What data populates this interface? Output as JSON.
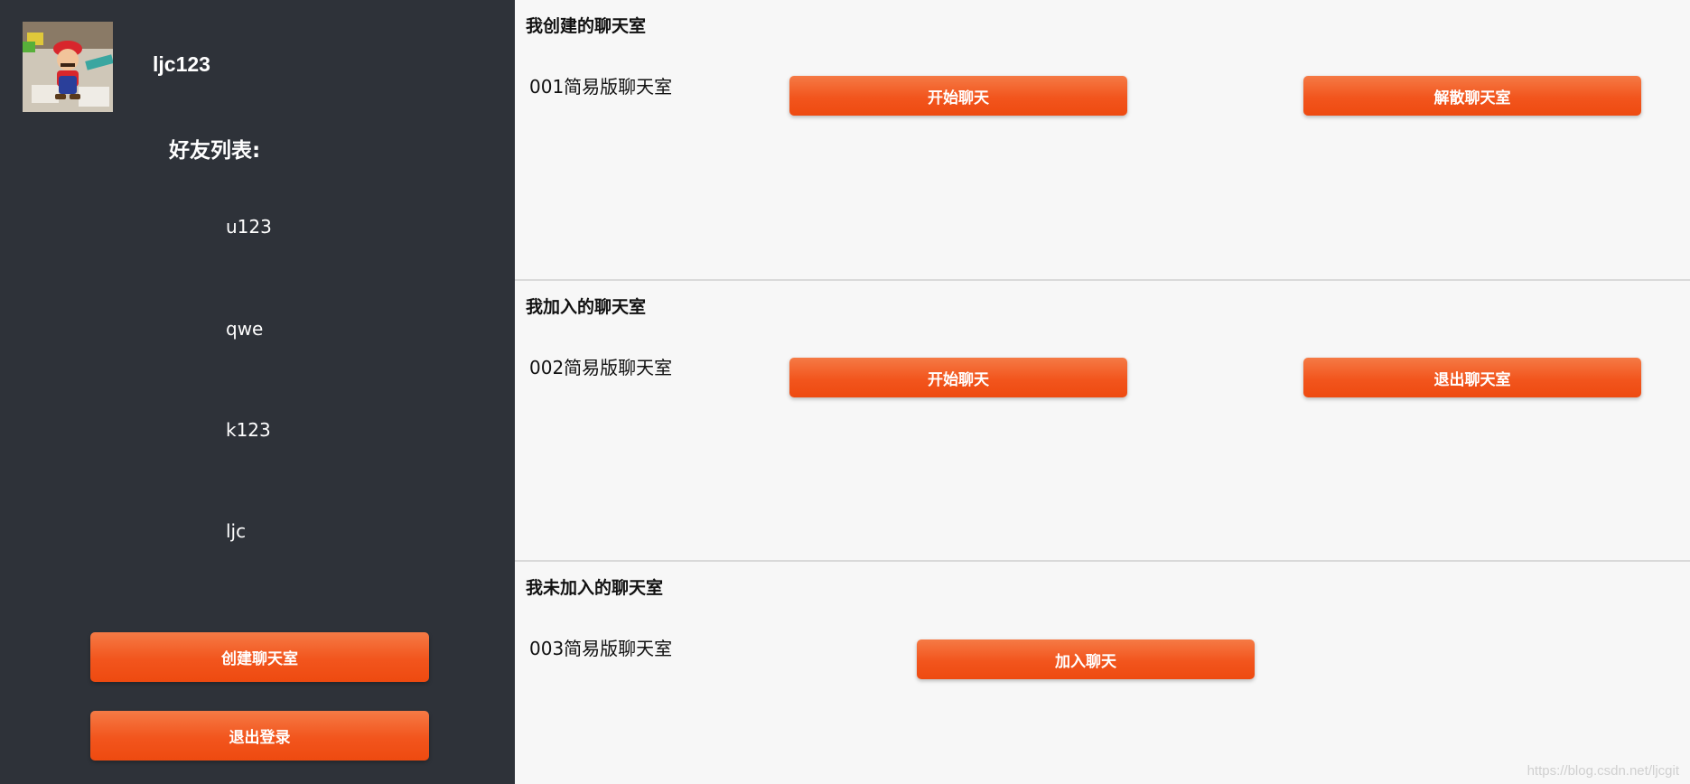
{
  "user": {
    "username": "ljc123"
  },
  "sidebar": {
    "friends_title": "好友列表:",
    "friends": [
      "u123",
      "qwe",
      "k123",
      "ljc"
    ],
    "create_room_label": "创建聊天室",
    "logout_label": "退出登录"
  },
  "sections": {
    "created": {
      "title": "我创建的聊天室",
      "room_name": "001简易版聊天室",
      "start_label": "开始聊天",
      "dissolve_label": "解散聊天室"
    },
    "joined": {
      "title": "我加入的聊天室",
      "room_name": "002简易版聊天室",
      "start_label": "开始聊天",
      "quit_label": "退出聊天室"
    },
    "not_joined": {
      "title": "我未加入的聊天室",
      "room_name": "003简易版聊天室",
      "join_label": "加入聊天"
    }
  },
  "watermark": "https://blog.csdn.net/ljcgit",
  "colors": {
    "sidebar_bg": "#2e3239",
    "main_bg": "#f7f7f7",
    "accent": "#f2551d"
  }
}
